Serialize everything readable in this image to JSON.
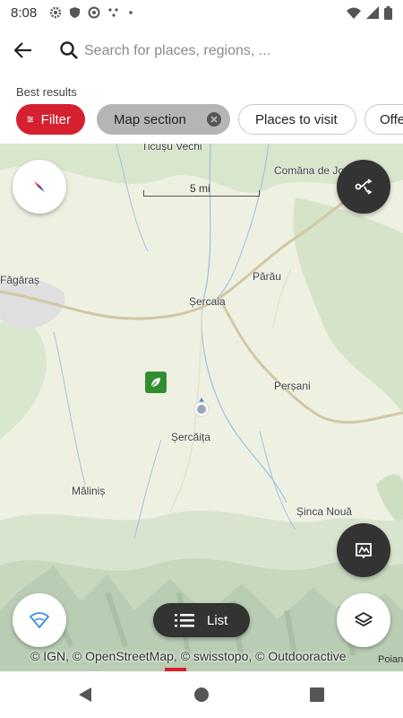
{
  "status_bar": {
    "time": "8:08",
    "icons": [
      "gear-icon",
      "shield-icon",
      "at-sign-icon",
      "dots-icon",
      "dot-icon",
      "wifi-icon",
      "signal-icon",
      "battery-icon"
    ]
  },
  "header": {
    "back_icon": "arrow-back-icon",
    "search_icon": "search-icon",
    "search_placeholder": "Search for places, regions, ...",
    "search_value": ""
  },
  "results": {
    "label": "Best results",
    "chips": [
      {
        "label": "Filter",
        "icon": "tune-icon",
        "active": true
      },
      {
        "label": "Map section",
        "icon": "clear-icon",
        "selected": true
      },
      {
        "label": "Places to visit"
      },
      {
        "label": "Offers"
      }
    ]
  },
  "map": {
    "scale_label": "5 mi",
    "places": [
      {
        "name": "Ticușu Vechi"
      },
      {
        "name": "Comăna de Jos"
      },
      {
        "name": "Făgăraș"
      },
      {
        "name": "Părău"
      },
      {
        "name": "Șercaia"
      },
      {
        "name": "Perșani"
      },
      {
        "name": "Șercăița"
      },
      {
        "name": "Măliniș"
      },
      {
        "name": "Șinca Nouă"
      },
      {
        "name": "Poiana Mă"
      }
    ],
    "attribution": "© IGN, © OpenStreetMap, © swisstopo, © Outdooractive",
    "list_label": "List",
    "buttons": {
      "compass": "compass-icon",
      "route": "route-icon",
      "guide": "map-book-icon",
      "wifi": "wifi-icon",
      "layers": "layers-icon",
      "list": "list-icon"
    }
  },
  "colors": {
    "accent": "#d4202f",
    "dark_button": "#333333",
    "chip_selected": "#b5b5b5",
    "map_base": "#eef1e2",
    "forest": "#cfe0c2"
  }
}
